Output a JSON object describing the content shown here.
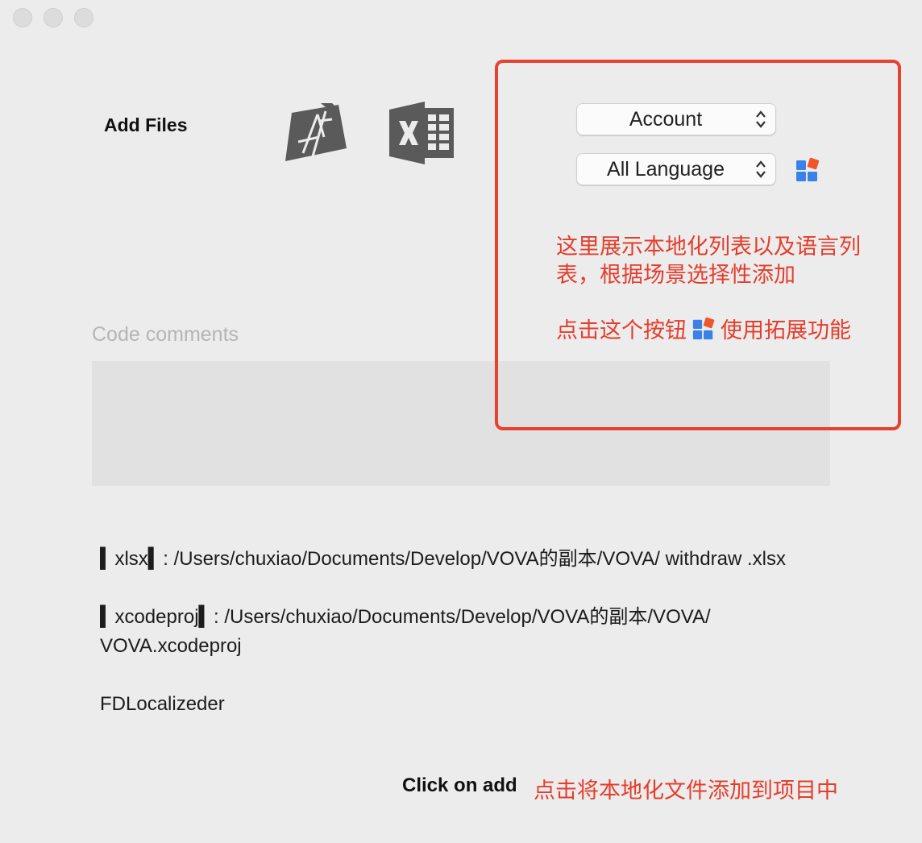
{
  "window": {
    "controls": [
      "close",
      "minimize",
      "zoom"
    ]
  },
  "header": {
    "add_files_label": "Add Files",
    "icons": [
      "xcode-icon",
      "excel-icon"
    ]
  },
  "selects": {
    "localization": {
      "value": "Account"
    },
    "language": {
      "value": "All Language"
    }
  },
  "extension_button": {
    "icon": "extension-icon"
  },
  "annotations": {
    "box_color": "#e8412f",
    "note_list": "这里展示本地化列表以及语言列表，根据场景选择性添加",
    "note_ext_before": "点击这个按钮",
    "note_ext_after": "使用拓展功能",
    "note_add": "点击将本地化文件添加到项目中"
  },
  "code_comments": {
    "placeholder": "Code comments",
    "value": ""
  },
  "files": [
    {
      "text": "▍xlsx▍: /Users/chuxiao/Documents/Develop/VOVA的副本/VOVA/ withdraw .xlsx"
    },
    {
      "text": "▍xcodeproj▍: /Users/chuxiao/Documents/Develop/VOVA的副本/VOVA/ VOVA.xcodeproj"
    },
    {
      "text": "FDLocalizeder"
    }
  ],
  "footer": {
    "add_button_label": "Click on add"
  },
  "colors": {
    "accent_red": "#e43d2c",
    "background": "#ececec"
  }
}
